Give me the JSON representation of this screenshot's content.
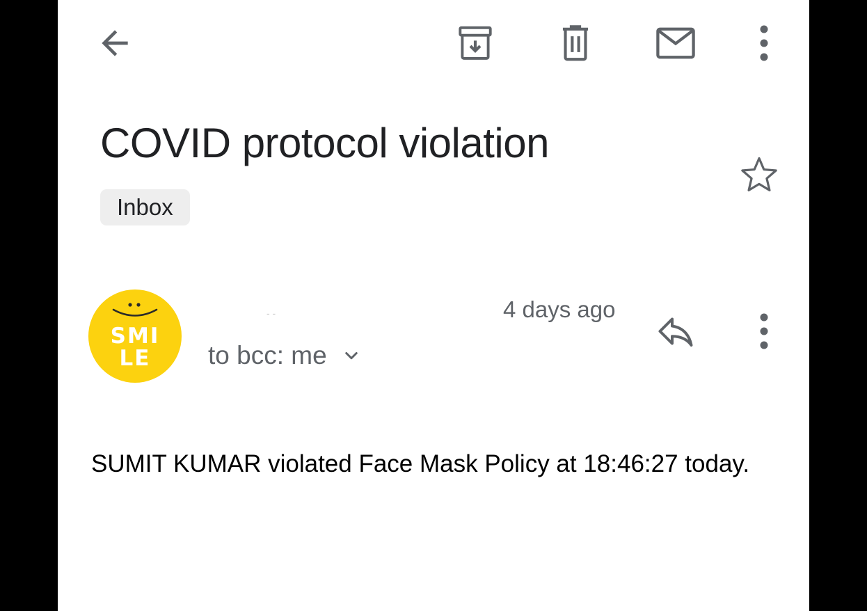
{
  "toolbar": {
    "icons": [
      "back-arrow-icon",
      "archive-icon",
      "delete-icon",
      "mark-unread-icon",
      "more-vert-icon"
    ],
    "icon_color": "#5f6368"
  },
  "email": {
    "subject": "COVID protocol violation",
    "label": "Inbox",
    "starred": false,
    "sender": {
      "name": "- -",
      "avatar_text_line1": "SMI",
      "avatar_text_line2": "LE",
      "avatar_color": "#fcd20f"
    },
    "date": "4 days ago",
    "recipients": "to bcc: me",
    "body": "SUMIT KUMAR violated Face Mask Policy at 18:46:27 today."
  },
  "colors": {
    "background": "#ffffff",
    "text_primary": "#202124",
    "text_secondary": "#5f6368",
    "chip_background": "#eeeeee"
  }
}
